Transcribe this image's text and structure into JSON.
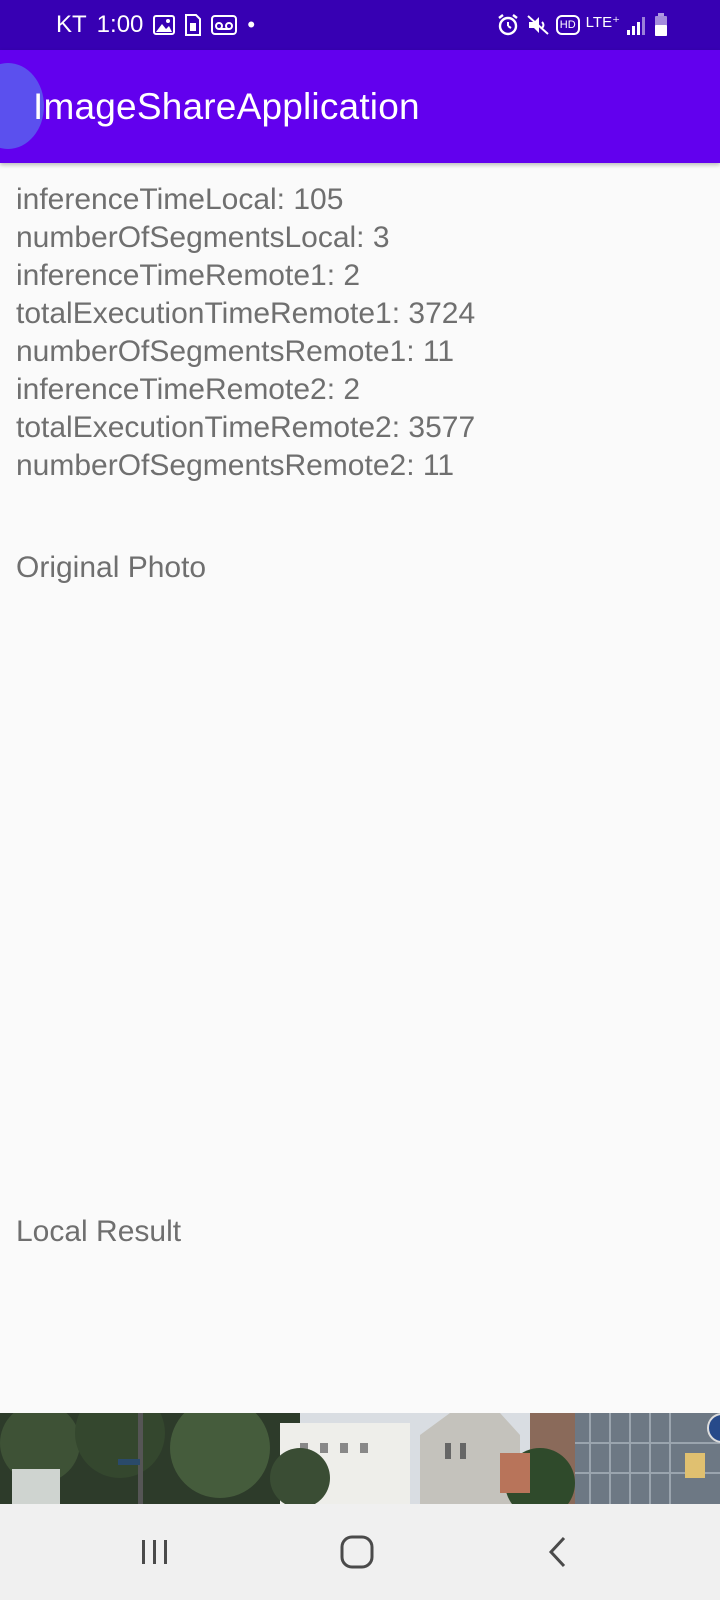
{
  "status_bar": {
    "carrier": "KT",
    "time": "1:00",
    "dot": "•",
    "network": "LTE⁺",
    "hd": "HD"
  },
  "app_bar": {
    "title": "ImageShareApplication"
  },
  "stats": [
    "inferenceTimeLocal: 105",
    "numberOfSegmentsLocal: 3",
    "inferenceTimeRemote1: 2",
    "totalExecutionTimeRemote1: 3724",
    "numberOfSegmentsRemote1: 11",
    "inferenceTimeRemote2: 2",
    "totalExecutionTimeRemote2: 3577",
    "numberOfSegmentsRemote2: 11"
  ],
  "sections": {
    "original_label": "Original Photo",
    "local_label": "Local Result"
  },
  "colors": {
    "status_bar": "#3700b3",
    "app_bar": "#6200ee",
    "background": "#fafafa",
    "text": "#6f6f6f"
  },
  "icons": [
    "gallery-icon",
    "sim-card-icon",
    "voicemail-icon",
    "alarm-icon",
    "mute-icon",
    "signal-icon",
    "battery-icon",
    "recent-apps-icon",
    "home-icon",
    "back-icon"
  ]
}
